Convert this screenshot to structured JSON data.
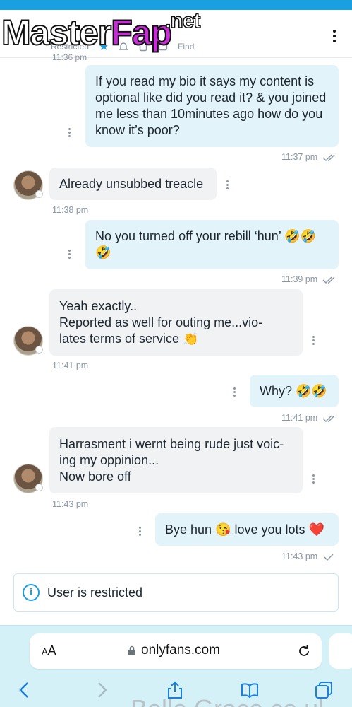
{
  "logo": {
    "master": "Master",
    "fap": "Fap",
    "net": ".net"
  },
  "header": {
    "status_text": "Restricted",
    "status_text_2": "Find"
  },
  "earlier_time": "11:36 pm",
  "messages": [
    {
      "dir": "out",
      "text": "If you read my bio it says my content is optional like did you read it? & you joined me less than 10minutes ago how do you know it’s poor?",
      "time": "11:37 pm",
      "read": true
    },
    {
      "dir": "in",
      "text": "Already unsubbed treacle",
      "time": "11:38 pm"
    },
    {
      "dir": "out",
      "text": "No you turned off your rebill ‘hun’ 🤣🤣\n🤣",
      "time": "11:39 pm",
      "read": true
    },
    {
      "dir": "in",
      "text": "Yeah exactly..\nReported as well for outing me...vio-\nlates terms of service 👏",
      "time": "11:41 pm"
    },
    {
      "dir": "out",
      "text": "Why? 🤣🤣",
      "time": "11:41 pm",
      "read": true
    },
    {
      "dir": "in",
      "text": "Harrasment i wernt being rude just voic-\ning my oppinion...\nNow bore off",
      "time": "11:43 pm"
    },
    {
      "dir": "out",
      "text": "Bye hun 😘 love you lots ❤️",
      "time": "11:43 pm",
      "read": false
    }
  ],
  "notice": {
    "text": "User is restricted",
    "icon": "info-icon"
  },
  "browser": {
    "aa_label_small": "A",
    "aa_label": "A",
    "url": "onlyfans.com"
  },
  "background_text": "Belle Grace co ul",
  "colors": {
    "accent": "#1a9fe0",
    "outgoing_bubble": "#e2f3f9",
    "incoming_bubble": "#f0f2f4",
    "chrome": "#d4f1f8"
  }
}
